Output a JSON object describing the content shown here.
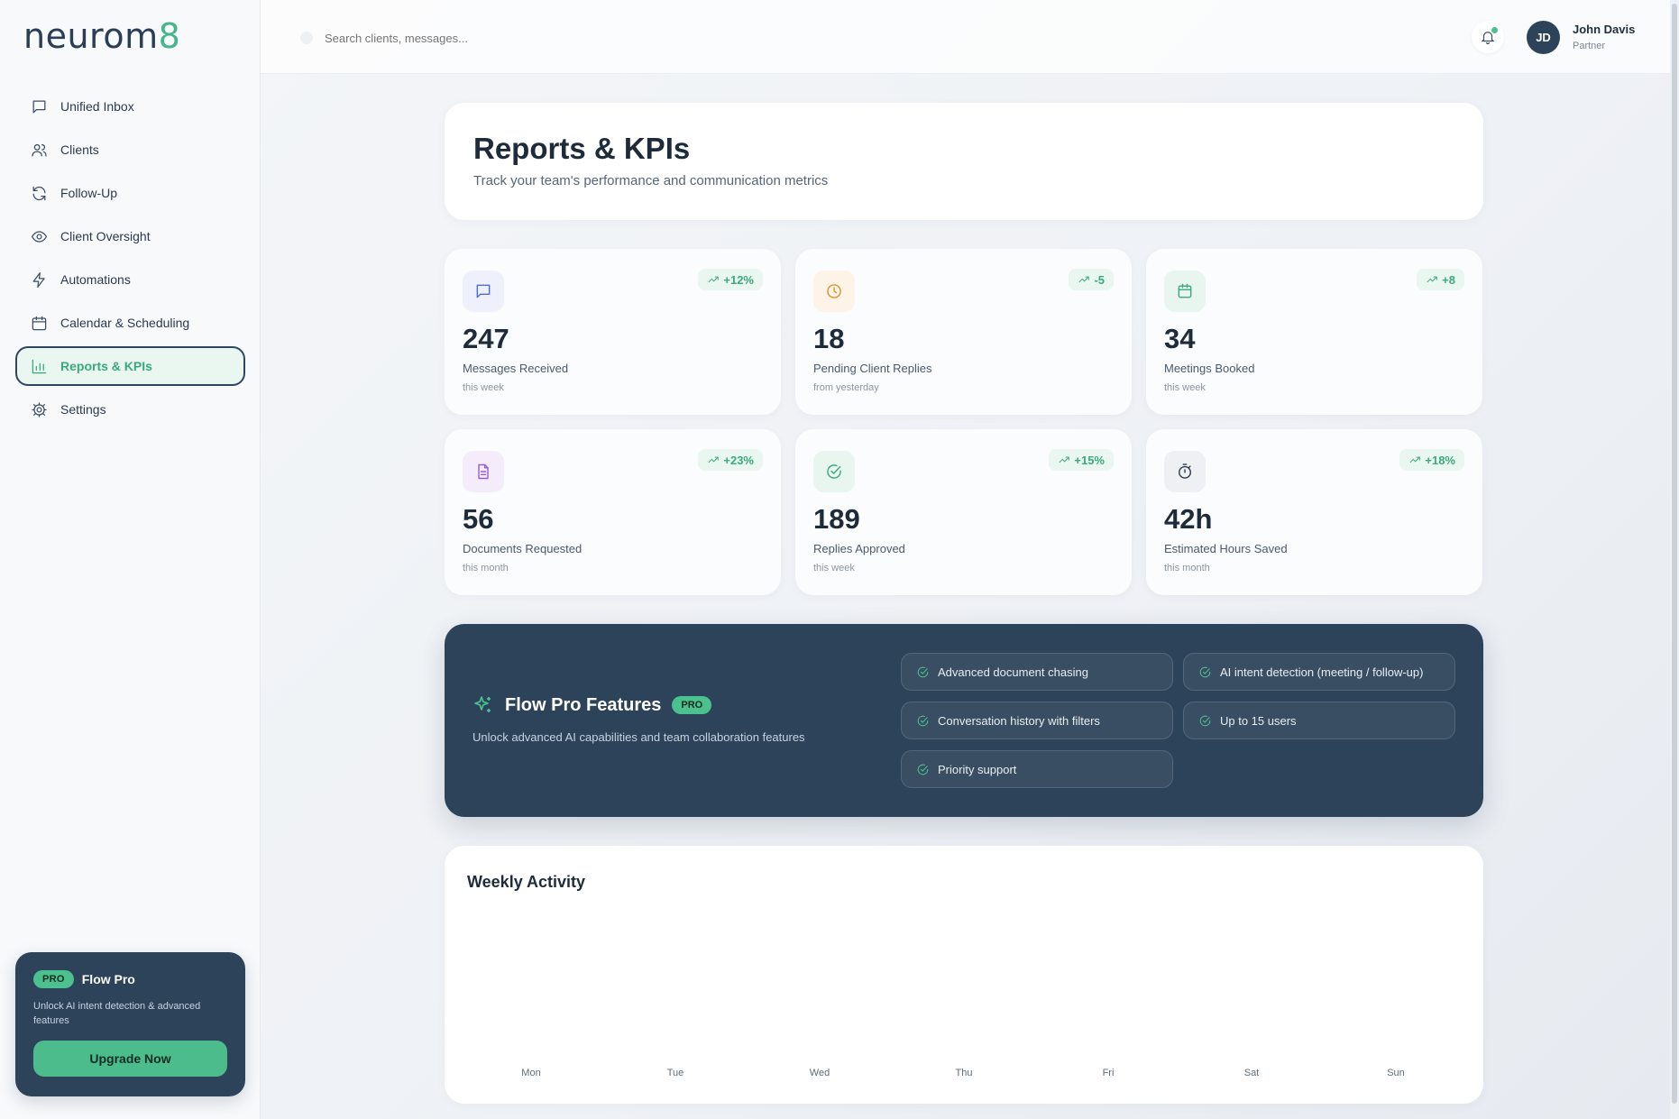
{
  "app": {
    "logo_text": "neurom",
    "logo_accent": "8"
  },
  "sidebar": {
    "items": [
      {
        "label": "Unified Inbox",
        "icon": "message-icon"
      },
      {
        "label": "Clients",
        "icon": "users-icon"
      },
      {
        "label": "Follow-Up",
        "icon": "refresh-icon"
      },
      {
        "label": "Client Oversight",
        "icon": "eye-icon"
      },
      {
        "label": "Automations",
        "icon": "bolt-icon"
      },
      {
        "label": "Calendar & Scheduling",
        "icon": "calendar-icon"
      },
      {
        "label": "Reports & KPIs",
        "icon": "bar-chart-icon",
        "active": true
      },
      {
        "label": "Settings",
        "icon": "gear-icon"
      }
    ],
    "pro_card": {
      "badge": "PRO",
      "title": "Flow Pro",
      "description": "Unlock AI intent detection & advanced features",
      "button": "Upgrade Now"
    }
  },
  "topbar": {
    "search_placeholder": "Search clients, messages...",
    "user": {
      "initials": "JD",
      "name": "John Davis",
      "role": "Partner"
    }
  },
  "page": {
    "title": "Reports & KPIs",
    "subtitle": "Track your team's performance and communication metrics"
  },
  "kpis": [
    {
      "value": "247",
      "label": "Messages Received",
      "sub": "this week",
      "trend": "+12%",
      "icon": "message-icon",
      "icon_color": "#4f6bd8",
      "icon_bg": "#eef1fb"
    },
    {
      "value": "18",
      "label": "Pending Client Replies",
      "sub": "from yesterday",
      "trend": "-5",
      "icon": "clock-icon",
      "icon_color": "#e0912e",
      "icon_bg": "#fdf3e6"
    },
    {
      "value": "34",
      "label": "Meetings Booked",
      "sub": "this week",
      "trend": "+8",
      "icon": "calendar-icon",
      "icon_color": "#3aa97d",
      "icon_bg": "#e8f6ef"
    },
    {
      "value": "56",
      "label": "Documents Requested",
      "sub": "this month",
      "trend": "+23%",
      "icon": "document-icon",
      "icon_color": "#9a5bd3",
      "icon_bg": "#f4ecfb"
    },
    {
      "value": "189",
      "label": "Replies Approved",
      "sub": "this week",
      "trend": "+15%",
      "icon": "check-circle-icon",
      "icon_color": "#3aa97d",
      "icon_bg": "#e8f6ef"
    },
    {
      "value": "42h",
      "label": "Estimated Hours Saved",
      "sub": "this month",
      "trend": "+18%",
      "icon": "stopwatch-icon",
      "icon_color": "#2d3b4c",
      "icon_bg": "#eef0f3"
    }
  ],
  "features": {
    "title": "Flow Pro Features",
    "badge": "PRO",
    "description": "Unlock advanced AI capabilities and team collaboration features",
    "items": [
      "Advanced document chasing",
      "AI intent detection (meeting / follow-up)",
      "Conversation history with filters",
      "Up to 15 users",
      "Priority support"
    ]
  },
  "weekly": {
    "title": "Weekly Activity",
    "days": [
      "Mon",
      "Tue",
      "Wed",
      "Thu",
      "Fri",
      "Sat",
      "Sun"
    ]
  },
  "colors": {
    "accent": "#4cc08e",
    "navy": "#2d435a"
  }
}
